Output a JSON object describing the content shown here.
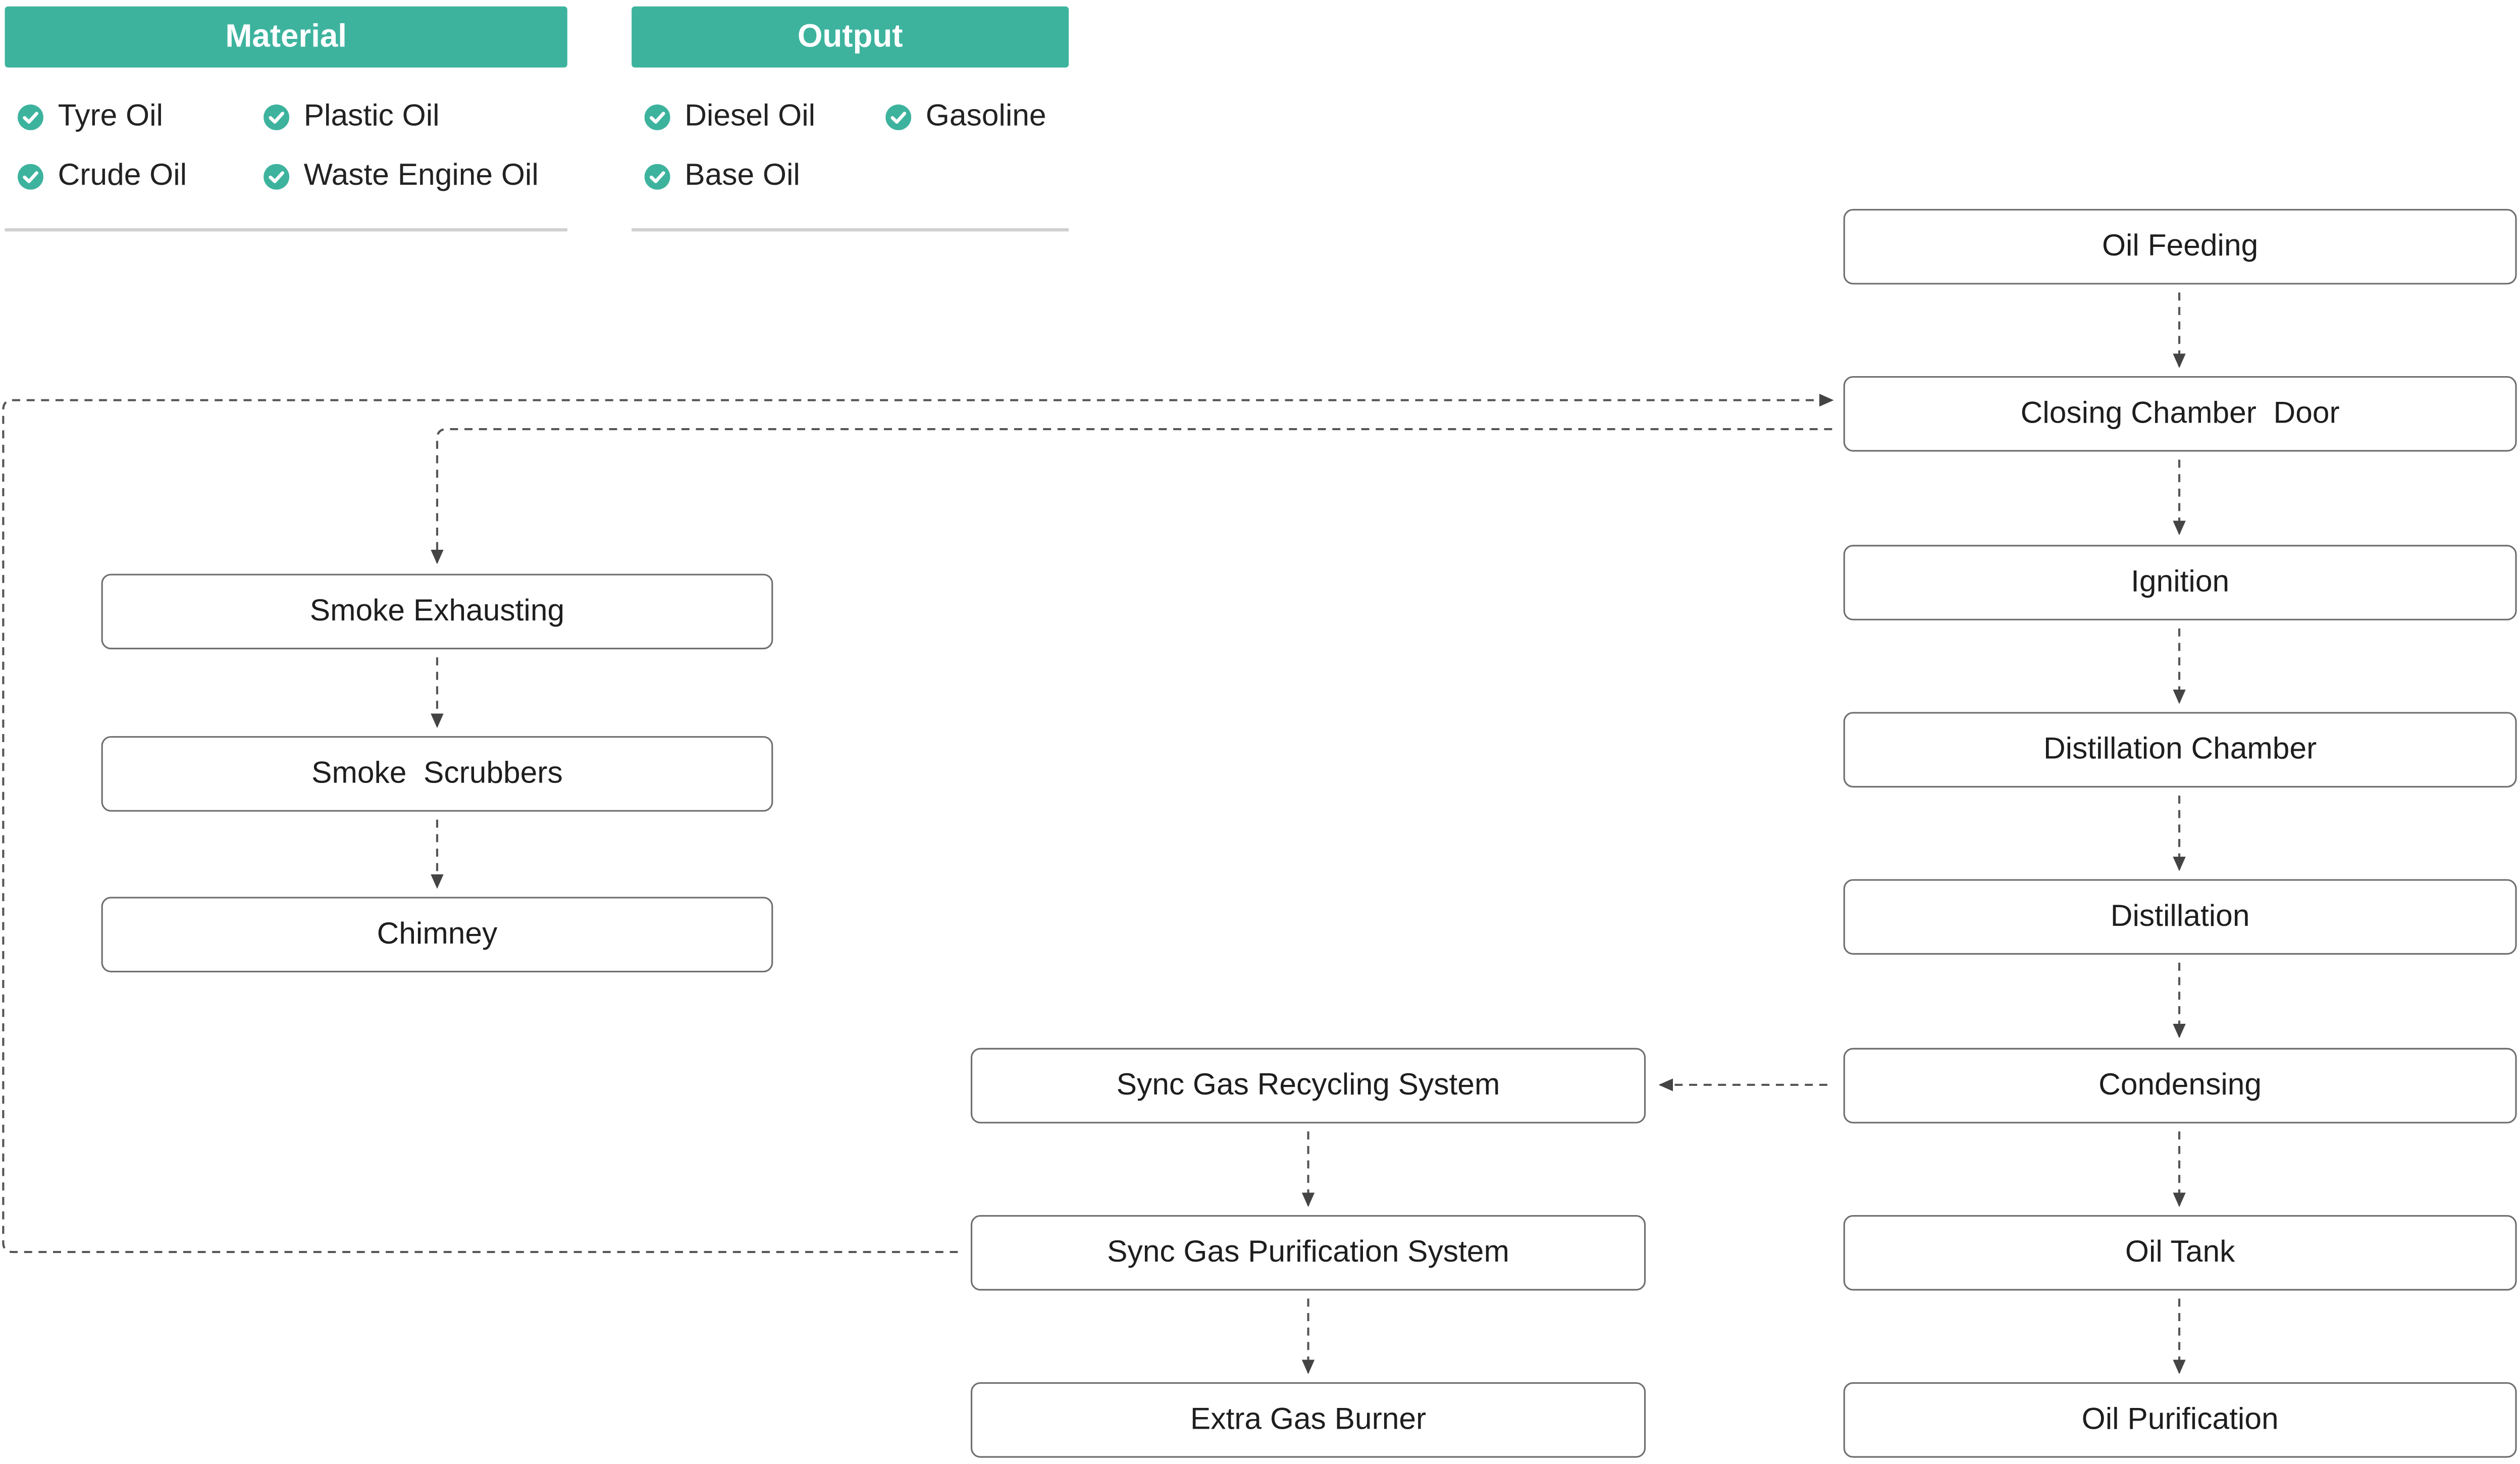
{
  "accent_color": "#3db39e",
  "material": {
    "title": "Material",
    "items": [
      "Tyre Oil",
      "Plastic Oil",
      "Crude Oil",
      "Waste Engine Oil"
    ]
  },
  "output": {
    "title": "Output",
    "items": [
      "Diesel Oil",
      "Gasoline",
      "Base Oil"
    ]
  },
  "check_icon": "check-circle-icon",
  "nodes": {
    "oil_feeding": "Oil Feeding",
    "closing_chamber_door": "Closing Chamber  Door",
    "ignition": "Ignition",
    "distillation_chamber": "Distillation Chamber",
    "distillation": "Distillation",
    "condensing": "Condensing",
    "oil_tank": "Oil Tank",
    "oil_purification": "Oil Purification",
    "smoke_exhausting": "Smoke Exhausting",
    "smoke_scrubbers": "Smoke  Scrubbers",
    "chimney": "Chimney",
    "sync_gas_recycling": "Sync Gas Recycling System",
    "sync_gas_purification": "Sync Gas Purification System",
    "extra_gas_burner": "Extra Gas Burner"
  }
}
